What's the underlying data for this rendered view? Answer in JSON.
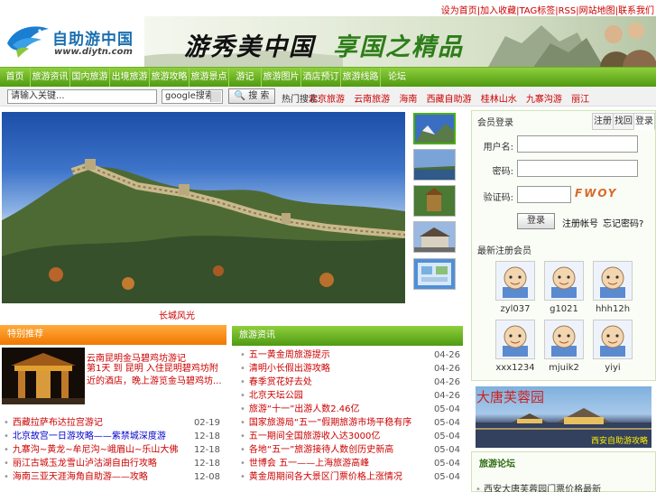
{
  "top_links": {
    "link1": "设为首页",
    "sep1": "|",
    "link2": "加入收藏",
    "sep2": "|",
    "link3": "TAG标签",
    "sep3": "|",
    "link4": "RSS",
    "sep4": "|",
    "link5": "网站地图",
    "sep5": "|",
    "link6": "联系我们"
  },
  "logo": {
    "title": "自助游中国",
    "url": "www.diytn.com"
  },
  "banner": {
    "text1": "游秀美中国",
    "text2": "享国之精品"
  },
  "nav": [
    "首页",
    "旅游资讯",
    "国内旅游",
    "出境旅游",
    "旅游攻略",
    "旅游景点",
    "游记",
    "旅游图片",
    "酒店预订",
    "旅游线路",
    "论坛"
  ],
  "search": {
    "placeholder": "请输入关键...",
    "engine": "google搜索",
    "button_label": "搜 索",
    "hot_label": "热门搜索:",
    "hot_links": [
      "北京旅游",
      "云南旅游",
      "海南",
      "西藏自助游",
      "桂林山水",
      "九寨沟游",
      "丽江"
    ]
  },
  "photo": {
    "caption": "长城风光"
  },
  "login": {
    "title": "会员登录",
    "tabs": [
      "注册",
      "找回",
      "登录"
    ],
    "username_label": "用户名:",
    "password_label": "密码:",
    "captcha_label": "验证码:",
    "captcha_text": "FWOY",
    "login_button": "登录",
    "register_link": "注册帐号",
    "forgot_link": "忘记密码?",
    "members_title": "最新注册会员",
    "members": [
      "zyl037",
      "g1021",
      "hhh12h",
      "xxx1234",
      "mjuik2",
      "yiyi"
    ]
  },
  "ad": {
    "title": "大唐芙蓉园",
    "subtitle": "西安自助游攻略"
  },
  "right_section": {
    "title": "旅游论坛",
    "first_item": "西安大唐芙蓉园门票价格最新"
  },
  "featured": {
    "header": "特别推荐",
    "title": "云南昆明金马碧鸡坊游记",
    "description": "第1天 到 昆明 入住昆明碧鸡坊附近的酒店，晚上游览金马碧鸡坊..."
  },
  "featured_list": [
    {
      "title": "西藏拉萨布达拉宫游记",
      "date": "02-19"
    },
    {
      "title": "北京故宫一日游攻略——紫禁城深度游",
      "date": "12-18"
    },
    {
      "title": "九寨沟~黄龙~牟尼沟~峨眉山~乐山大佛",
      "date": "12-18"
    },
    {
      "title": "丽江古城玉龙雪山泸沽湖自由行攻略",
      "date": "12-18"
    },
    {
      "title": "海南三亚天涯海角自助游——攻略",
      "date": "12-08"
    }
  ],
  "news": {
    "header": "旅游资讯",
    "items": [
      {
        "title": "五一黄金周旅游提示",
        "date": "04-26"
      },
      {
        "title": "清明小长假出游攻略",
        "date": "04-26"
      },
      {
        "title": "春季赏花好去处",
        "date": "04-26"
      },
      {
        "title": "北京天坛公园",
        "date": "04-26"
      },
      {
        "title": "旅游“十一”出游人数2.46亿",
        "date": "05-04"
      },
      {
        "title": "国家旅游局“五一”假期旅游市场平稳有序",
        "date": "05-04"
      },
      {
        "title": "五一期间全国旅游收入达3000亿",
        "date": "05-04"
      },
      {
        "title": "各地“五一”旅游接待人数创历史新高",
        "date": "05-04"
      },
      {
        "title": "世博会 五一——上海旅游高峰",
        "date": "05-04"
      },
      {
        "title": "黄金周期间各大景区门票价格上涨情况",
        "date": "05-04"
      }
    ]
  },
  "colors": {
    "accent_red": "#cc0000",
    "nav_green": "#4f9a12",
    "header_orange": "#f07800"
  }
}
